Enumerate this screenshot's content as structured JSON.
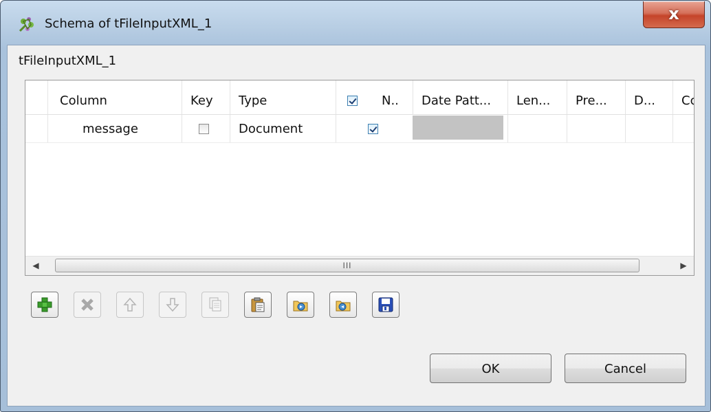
{
  "window": {
    "title": "Schema of tFileInputXML_1",
    "close_glyph": "x"
  },
  "component_label": "tFileInputXML_1",
  "table": {
    "columns": [
      "Column",
      "Key",
      "Type",
      "N..",
      "Date Patt...",
      "Len...",
      "Pre...",
      "D...",
      "Cc"
    ],
    "nullable_header_checked": true,
    "rows": [
      {
        "column": "message",
        "key": false,
        "type": "Document",
        "nullable": true
      }
    ]
  },
  "scrollbar": {
    "left_arrow": "◀",
    "right_arrow": "▶",
    "grip": "III"
  },
  "toolbar": {
    "icons": [
      "add-icon",
      "remove-icon",
      "move-up-icon",
      "move-down-icon",
      "copy-icon",
      "paste-icon",
      "import-icon",
      "export-icon",
      "save-icon"
    ],
    "accent_add": "#3a9b2b",
    "accent_save": "#1f3f9c"
  },
  "buttons": {
    "ok": "OK",
    "cancel": "Cancel"
  }
}
